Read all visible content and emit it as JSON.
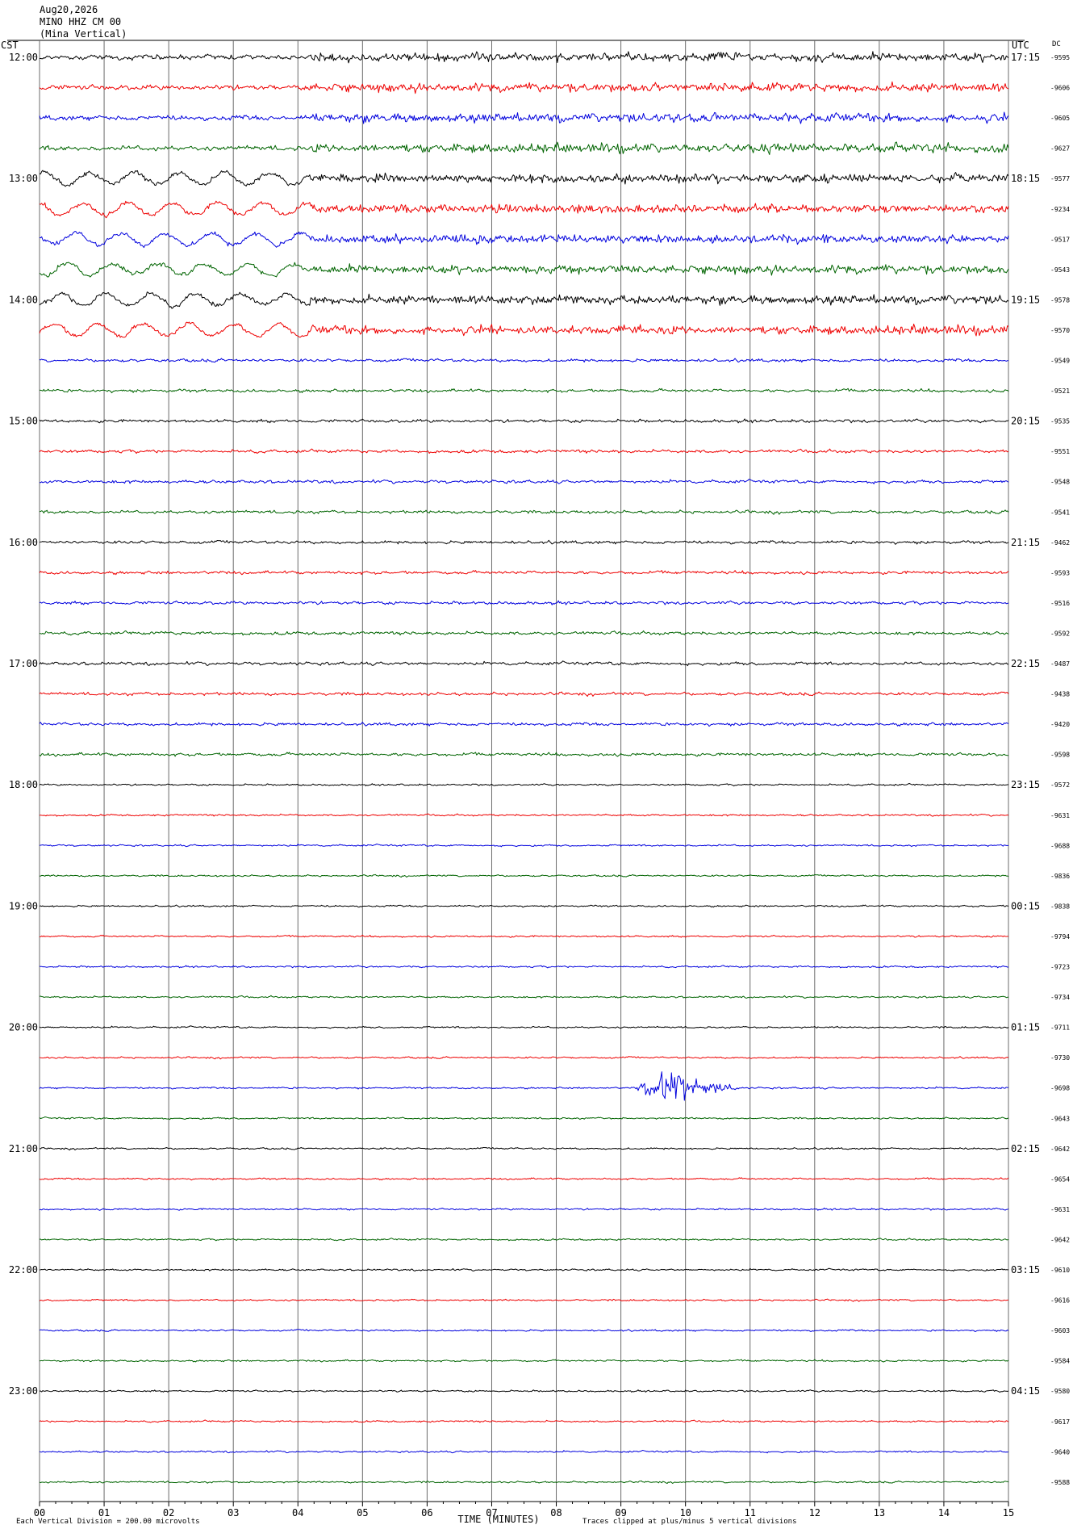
{
  "header": {
    "date": "Aug20,2026",
    "station": "MINO HHZ CM 00",
    "location": "(Mina Vertical)"
  },
  "chart_data": {
    "type": "line",
    "title": "",
    "left_timezone_label": "CST",
    "right_timezone_label": "UTC",
    "dc_header": "DC",
    "xlabel": "TIME (MINUTES)",
    "x_tick_labels": [
      "00",
      "01",
      "02",
      "03",
      "04",
      "05",
      "06",
      "07",
      "08",
      "09",
      "10",
      "11",
      "12",
      "13",
      "14",
      "15"
    ],
    "xlim": [
      0,
      15
    ],
    "left_hour_labels": [
      "12:00",
      "13:00",
      "14:00",
      "15:00",
      "16:00",
      "17:00",
      "18:00",
      "19:00",
      "20:00",
      "21:00",
      "22:00",
      "23:00"
    ],
    "right_hour_labels": [
      "17:15",
      "18:15",
      "19:15",
      "20:15",
      "21:15",
      "22:15",
      "23:15",
      "00:15",
      "01:15",
      "02:15",
      "03:15",
      "04:15"
    ],
    "trace_colors": [
      "#000000",
      "#ee0000",
      "#0000dd",
      "#006400"
    ],
    "traces_per_hour": 4,
    "minutes_per_trace": 15,
    "dc_offsets": [
      -9595,
      -9606,
      -9605,
      -9627,
      -9577,
      -9234,
      -9517,
      -9543,
      -9578,
      -9570,
      -9549,
      -9521,
      -9535,
      -9551,
      -9548,
      -9541,
      -9462,
      -9593,
      -9516,
      -9592,
      -9487,
      -9438,
      -9420,
      -9598,
      -9572,
      -9631,
      -9688,
      -9836,
      -9838,
      -9794,
      -9723,
      -9734,
      -9711,
      -9730,
      -9698,
      -9643,
      -9642,
      -9654,
      -9631,
      -9642,
      -9610,
      -9616,
      -9603,
      -9584,
      -9580,
      -9617,
      -9640,
      -9588
    ],
    "events": [
      {
        "trace_index": 34,
        "start_minute": 9.2,
        "end_minute": 10.8,
        "description": "earthquake signal"
      }
    ],
    "footer_left": "Each Vertical Division =  200.00 microvolts",
    "footer_right": "Traces clipped at plus/minus 5 vertical divisions"
  }
}
